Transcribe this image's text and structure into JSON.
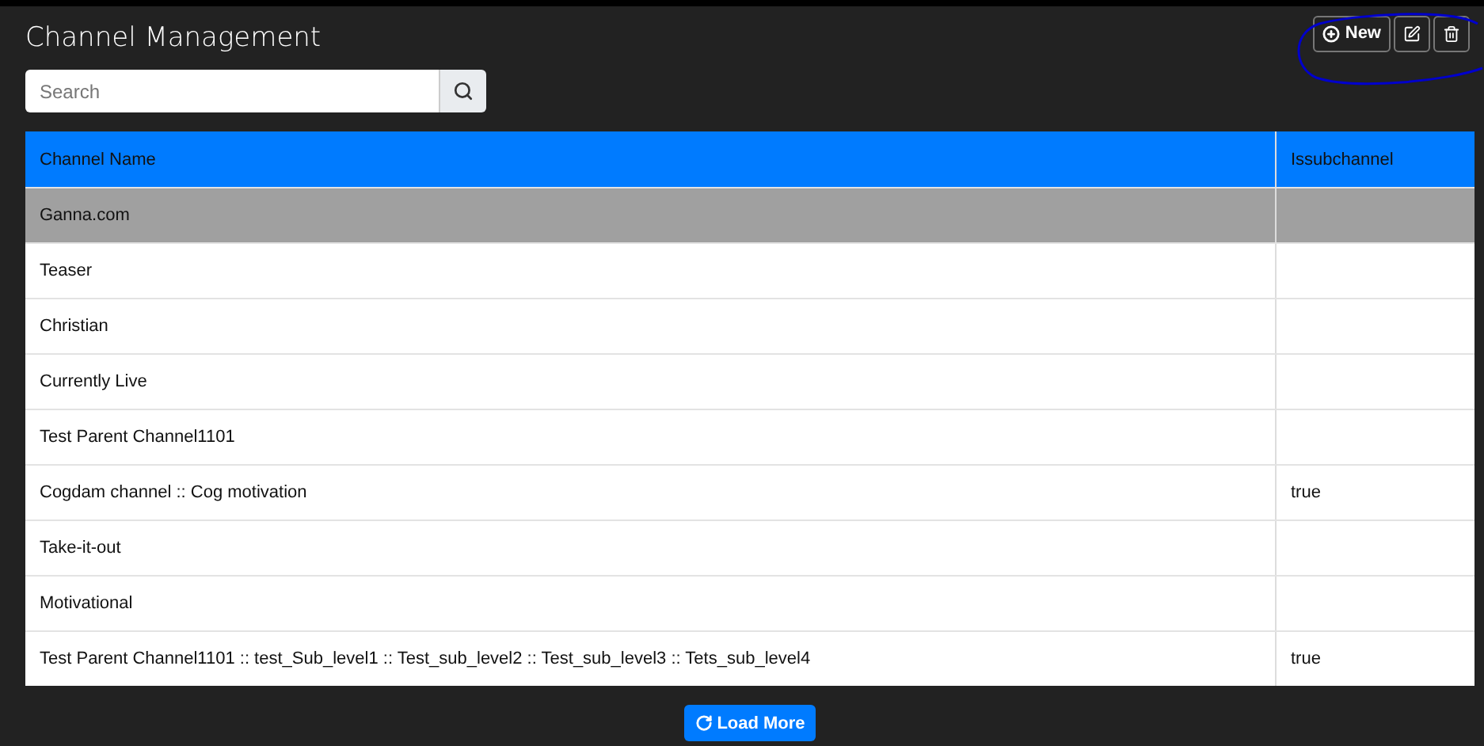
{
  "title": "Channel Management",
  "toolbar": {
    "new_label": "New"
  },
  "search": {
    "placeholder": "Search"
  },
  "table": {
    "columns": [
      "Channel Name",
      "Issubchannel"
    ],
    "rows": [
      {
        "name": "Ganna.com",
        "issubchannel": "",
        "selected": true
      },
      {
        "name": "Teaser",
        "issubchannel": "",
        "selected": false
      },
      {
        "name": "Christian",
        "issubchannel": "",
        "selected": false
      },
      {
        "name": "Currently Live",
        "issubchannel": "",
        "selected": false
      },
      {
        "name": "Test Parent Channel1101",
        "issubchannel": "",
        "selected": false
      },
      {
        "name": "Cogdam channel :: Cog motivation",
        "issubchannel": "true",
        "selected": false
      },
      {
        "name": "Take-it-out",
        "issubchannel": "",
        "selected": false
      },
      {
        "name": "Motivational",
        "issubchannel": "",
        "selected": false
      },
      {
        "name": "Test Parent Channel1101 :: test_Sub_level1 :: Test_sub_level2 :: Test_sub_level3 :: Tets_sub_level4",
        "issubchannel": "true",
        "selected": false
      }
    ]
  },
  "load_more": {
    "label": "Load More"
  }
}
